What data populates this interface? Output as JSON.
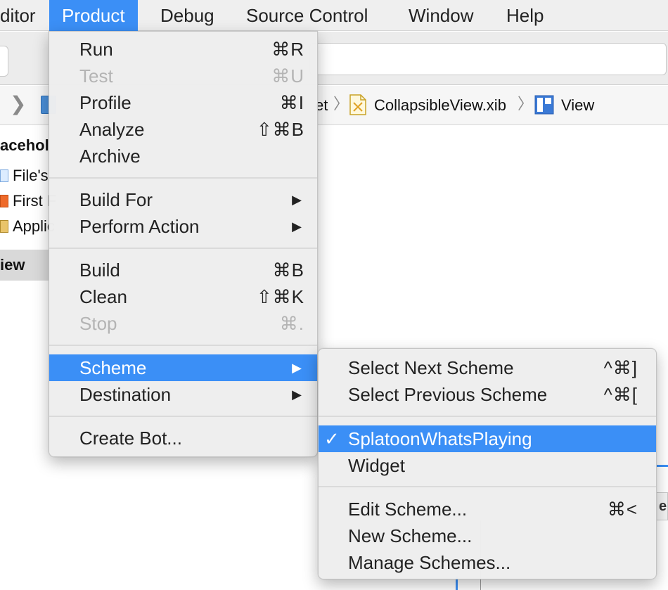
{
  "menubar": {
    "items": [
      {
        "label": "ditor"
      },
      {
        "label": "Product"
      },
      {
        "label": "Debug"
      },
      {
        "label": "Source Control"
      },
      {
        "label": "Window"
      },
      {
        "label": "Help"
      }
    ]
  },
  "jumpbar": {
    "partial_crumb": "et",
    "file_crumb": "CollapsibleView.xib",
    "view_crumb": "View"
  },
  "outline": {
    "section_placeholder": "acehol",
    "items": [
      "File's",
      "First F",
      "Applic"
    ],
    "section_view": "iew"
  },
  "panel_edge_text": "eri",
  "product_menu": {
    "run": {
      "label": "Run",
      "shortcut": "⌘R"
    },
    "test": {
      "label": "Test",
      "shortcut": "⌘U"
    },
    "profile": {
      "label": "Profile",
      "shortcut": "⌘I"
    },
    "analyze": {
      "label": "Analyze",
      "shortcut": "⇧⌘B"
    },
    "archive": {
      "label": "Archive"
    },
    "build_for": {
      "label": "Build For"
    },
    "perform_action": {
      "label": "Perform Action"
    },
    "build": {
      "label": "Build",
      "shortcut": "⌘B"
    },
    "clean": {
      "label": "Clean",
      "shortcut": "⇧⌘K"
    },
    "stop": {
      "label": "Stop",
      "shortcut": "⌘."
    },
    "scheme": {
      "label": "Scheme"
    },
    "destination": {
      "label": "Destination"
    },
    "create_bot": {
      "label": "Create Bot..."
    },
    "submenu_arrow": "▶"
  },
  "scheme_menu": {
    "select_next": {
      "label": "Select Next Scheme",
      "shortcut": "^⌘]"
    },
    "select_previous": {
      "label": "Select Previous Scheme",
      "shortcut": "^⌘["
    },
    "splatoon": {
      "label": "SplatoonWhatsPlaying",
      "check": "✓"
    },
    "widget": {
      "label": "Widget"
    },
    "edit_scheme": {
      "label": "Edit Scheme...",
      "shortcut": "⌘<"
    },
    "new_scheme": {
      "label": "New Scheme..."
    },
    "manage_schemes": {
      "label": "Manage Schemes..."
    }
  },
  "colors": {
    "highlight": "#3b8ff6",
    "menu_bg": "#eeeeee",
    "disabled_text": "#b4b4b4"
  },
  "icons": [
    "project-file-icon",
    "xib-file-icon",
    "view-icon",
    "chevron-right-icon",
    "checkmark-icon",
    "submenu-arrow-icon"
  ]
}
